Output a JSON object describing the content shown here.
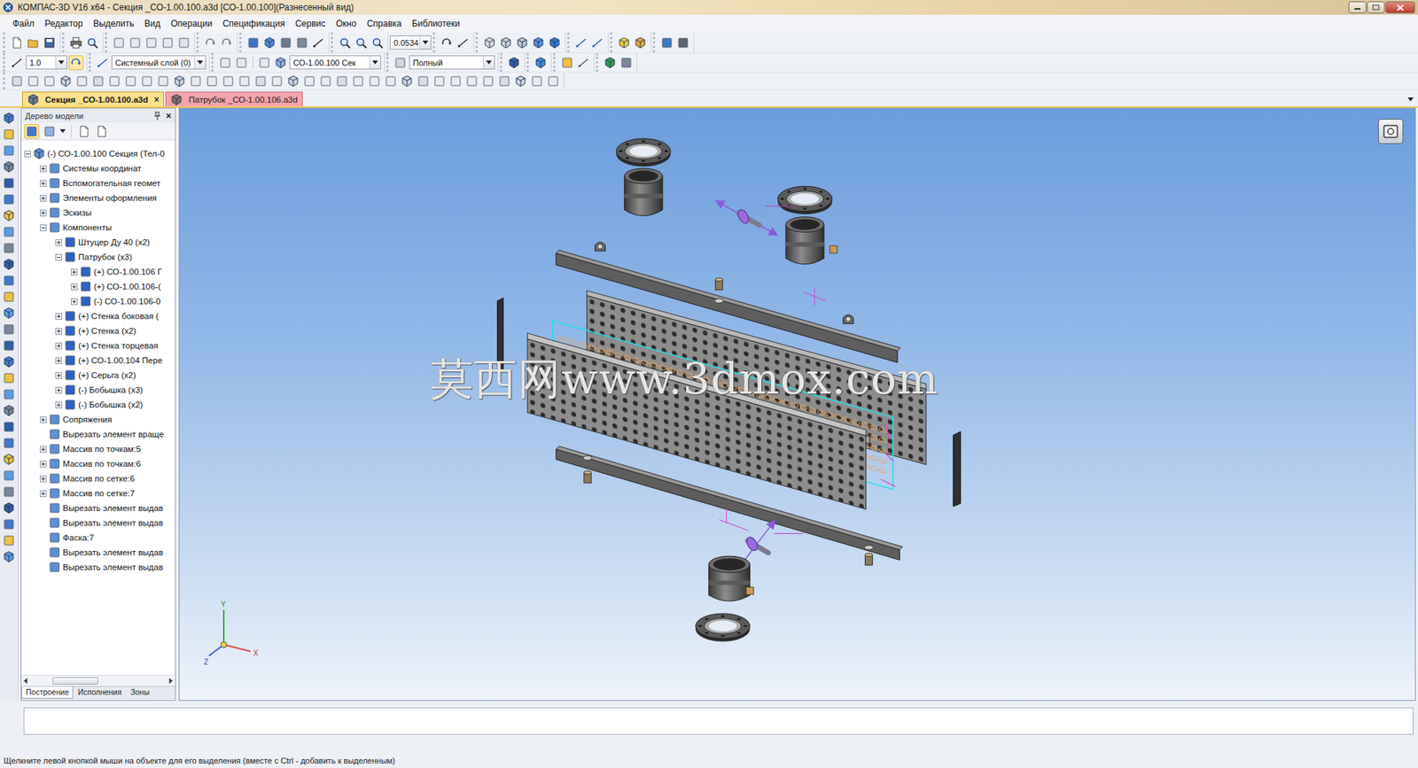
{
  "window": {
    "title": "КОМПАС-3D V16  x64 - Секция _СО-1.00.100.a3d [СО-1.00.100](Разнесенный вид)"
  },
  "menu": [
    "Файл",
    "Редактор",
    "Выделить",
    "Вид",
    "Операции",
    "Спецификация",
    "Сервис",
    "Окно",
    "Справка",
    "Библиотеки"
  ],
  "toolbar": {
    "zoom": "0.0534",
    "step": "1.0",
    "layer": "Системный слой (0)",
    "part": "СО-1.00.100 Сек",
    "render": "Полный"
  },
  "doc_tabs": [
    {
      "label": "Секция _СО-1.00.100.a3d",
      "selected": true,
      "close": "×",
      "color": "#fbe08a"
    },
    {
      "label": "Патрубок _СО-1.00.106.a3d",
      "selected": false,
      "close": "",
      "color": "#f4a3ab"
    }
  ],
  "tree_panel": {
    "title": "Дерево модели",
    "close": "×",
    "items": [
      {
        "label": "(-) СО-1.00.100 Секция (Тел-0",
        "level": 0,
        "has_children": true,
        "expanded": true
      },
      {
        "label": "Системы координат",
        "level": 1,
        "has_children": true,
        "expanded": false
      },
      {
        "label": "Вспомогательная геомет",
        "level": 1,
        "has_children": true,
        "expanded": false
      },
      {
        "label": "Элементы оформления",
        "level": 1,
        "has_children": true,
        "expanded": false
      },
      {
        "label": "Эскизы",
        "level": 1,
        "has_children": true,
        "expanded": false
      },
      {
        "label": "Компоненты",
        "level": 1,
        "has_children": true,
        "expanded": true
      },
      {
        "label": "Штуцер Ду 40 (х2)",
        "level": 2,
        "has_children": true,
        "expanded": false
      },
      {
        "label": "Патрубок (х3)",
        "level": 2,
        "has_children": true,
        "expanded": true
      },
      {
        "label": "(+) СО-1.00.106 Г",
        "level": 3,
        "has_children": true,
        "expanded": false
      },
      {
        "label": "(+) СО-1.00.106-(",
        "level": 3,
        "has_children": true,
        "expanded": false
      },
      {
        "label": "(-) СО-1.00.106-0",
        "level": 3,
        "has_children": true,
        "expanded": false
      },
      {
        "label": "(+) Стенка боковая (",
        "level": 2,
        "has_children": true,
        "expanded": false
      },
      {
        "label": "(+) Стенка (х2)",
        "level": 2,
        "has_children": true,
        "expanded": false
      },
      {
        "label": "(+) Стенка торцевая",
        "level": 2,
        "has_children": true,
        "expanded": false
      },
      {
        "label": "(+) СО-1.00.104 Пере",
        "level": 2,
        "has_children": true,
        "expanded": false
      },
      {
        "label": "(+) Серьга (х2)",
        "level": 2,
        "has_children": true,
        "expanded": false
      },
      {
        "label": "(-) Бобышка (х3)",
        "level": 2,
        "has_children": true,
        "expanded": false
      },
      {
        "label": "(-) Бобышка (х2)",
        "level": 2,
        "has_children": true,
        "expanded": false
      },
      {
        "label": "Сопряжения",
        "level": 1,
        "has_children": true,
        "expanded": false
      },
      {
        "label": "Вырезать элемент враще",
        "level": 1,
        "has_children": false,
        "expanded": false
      },
      {
        "label": "Массив по точкам:5",
        "level": 1,
        "has_children": true,
        "expanded": false
      },
      {
        "label": "Массив по точкам:6",
        "level": 1,
        "has_children": true,
        "expanded": false
      },
      {
        "label": "Массив по сетке:6",
        "level": 1,
        "has_children": true,
        "expanded": false
      },
      {
        "label": "Массив по сетке:7",
        "level": 1,
        "has_children": true,
        "expanded": false
      },
      {
        "label": "Вырезать элемент выдав",
        "level": 1,
        "has_children": false,
        "expanded": false
      },
      {
        "label": "Вырезать элемент выдав",
        "level": 1,
        "has_children": false,
        "expanded": false
      },
      {
        "label": "Фаска:7",
        "level": 1,
        "has_children": false,
        "expanded": false
      },
      {
        "label": "Вырезать элемент выдав",
        "level": 1,
        "has_children": false,
        "expanded": false
      },
      {
        "label": "Вырезать элемент выдав",
        "level": 1,
        "has_children": false,
        "expanded": false
      }
    ]
  },
  "bottom_tabs": [
    {
      "label": "Построение",
      "selected": true
    },
    {
      "label": "Исполнения",
      "selected": false
    },
    {
      "label": "Зоны",
      "selected": false
    }
  ],
  "viewport": {
    "watermark": "莫西网www.3dmox.com",
    "axes": [
      "Y",
      "X",
      "Z"
    ]
  },
  "command_line": {
    "value": ""
  },
  "status_bar": "Щелкните левой кнопкой мыши на объекте для его выделения (вместе с Ctrl - добавить к выделенным)"
}
